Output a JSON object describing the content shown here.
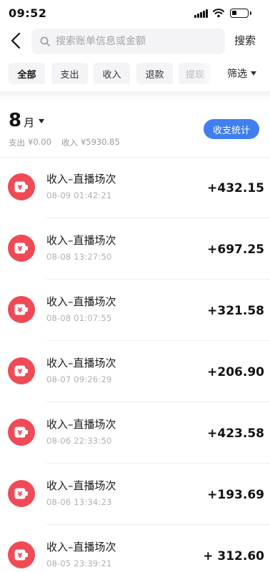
{
  "status_bar": {
    "time": "09:52"
  },
  "search": {
    "placeholder": "搜索账单信息或金额",
    "value": "",
    "button_label": "搜索"
  },
  "filters": {
    "chips": [
      "全部",
      "支出",
      "收入",
      "退款",
      "提现"
    ],
    "active": "全部",
    "filter_label": "筛选"
  },
  "summary": {
    "month_number": "8",
    "month_unit": "月",
    "expense_label": "支出",
    "expense_value": "¥0.00",
    "income_label": "收入",
    "income_value": "¥5930.85",
    "stats_button": "收支统计"
  },
  "colors": {
    "accent": "#3f7ff0",
    "income_icon": "#ef4a55"
  },
  "transactions": [
    {
      "icon": "yuan-wallet-icon",
      "title": "收入–直播场次",
      "time": "08-09 01:42:21",
      "amount": "+432.15"
    },
    {
      "icon": "yuan-wallet-icon",
      "title": "收入–直播场次",
      "time": "08-08 13:27:50",
      "amount": "+697.25"
    },
    {
      "icon": "yuan-wallet-icon",
      "title": "收入–直播场次",
      "time": "08-08 01:07:55",
      "amount": "+321.58"
    },
    {
      "icon": "yuan-wallet-icon",
      "title": "收入–直播场次",
      "time": "08-07 09:26:29",
      "amount": "+206.90"
    },
    {
      "icon": "yuan-wallet-icon",
      "title": "收入–直播场次",
      "time": "08-06 22:33:50",
      "amount": "+423.58"
    },
    {
      "icon": "yuan-wallet-icon",
      "title": "收入–直播场次",
      "time": "08-06 13:34:23",
      "amount": "+193.69"
    },
    {
      "icon": "yuan-wallet-icon",
      "title": "收入–直播场次",
      "time": "08-05 23:39:21",
      "amount": "+ 312.60"
    }
  ]
}
